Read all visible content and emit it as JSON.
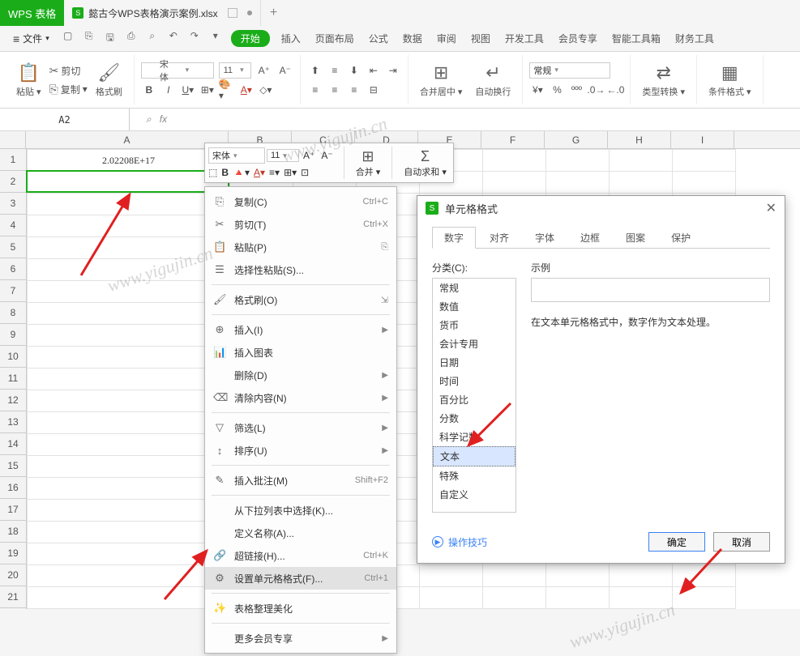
{
  "app": {
    "brand": "WPS 表格"
  },
  "document": {
    "name": "懿古今WPS表格演示案例.xlsx",
    "icon_letter": "S"
  },
  "menubar": {
    "file_label": "文件",
    "quick_icons": [
      "□",
      "⎘",
      "🖨",
      "⟲",
      "⟳",
      "⎌",
      "⎌",
      "▽"
    ],
    "start_tab": "开始",
    "items": [
      "插入",
      "页面布局",
      "公式",
      "数据",
      "审阅",
      "视图",
      "开发工具",
      "会员专享",
      "智能工具箱",
      "财务工具"
    ]
  },
  "ribbon": {
    "paste": "粘贴",
    "cut": "剪切",
    "copy": "复制",
    "format_painter": "格式刷",
    "font_name": "宋体",
    "font_size": "11",
    "merge_center": "合并居中",
    "wrap": "自动换行",
    "number_format": "常规",
    "type_convert": "类型转换",
    "cond_format": "条件格式"
  },
  "formulabar": {
    "cell_ref": "A2",
    "fx": "fx"
  },
  "grid": {
    "columns": [
      "A",
      "B",
      "C",
      "D",
      "E",
      "F",
      "G",
      "H",
      "I"
    ],
    "rows": 21,
    "A1": "2.02208E+17"
  },
  "mini_toolbar": {
    "font_name": "宋体",
    "font_size": "11",
    "merge": "合并",
    "autosum": "自动求和"
  },
  "context_menu": {
    "copy": "复制(C)",
    "copy_sc": "Ctrl+C",
    "cut": "剪切(T)",
    "cut_sc": "Ctrl+X",
    "paste": "粘贴(P)",
    "paste_special": "选择性粘贴(S)...",
    "format_painter": "格式刷(O)",
    "insert": "插入(I)",
    "insert_chart": "插入图表",
    "delete": "删除(D)",
    "clear": "清除内容(N)",
    "filter": "筛选(L)",
    "sort": "排序(U)",
    "insert_comment": "插入批注(M)",
    "comment_sc": "Shift+F2",
    "from_dropdown": "从下拉列表中选择(K)...",
    "define_name": "定义名称(A)...",
    "hyperlink": "超链接(H)...",
    "hyperlink_sc": "Ctrl+K",
    "format_cells": "设置单元格格式(F)...",
    "format_cells_sc": "Ctrl+1",
    "beautify": "表格整理美化",
    "more_member": "更多会员专享"
  },
  "dialog": {
    "title": "单元格格式",
    "icon_letter": "S",
    "tabs": [
      "数字",
      "对齐",
      "字体",
      "边框",
      "图案",
      "保护"
    ],
    "category_label": "分类(C):",
    "categories": [
      "常规",
      "数值",
      "货币",
      "会计专用",
      "日期",
      "时间",
      "百分比",
      "分数",
      "科学记数",
      "文本",
      "特殊",
      "自定义"
    ],
    "selected_category": "文本",
    "example_label": "示例",
    "description": "在文本单元格格式中，数字作为文本处理。",
    "tip": "操作技巧",
    "ok": "确定",
    "cancel": "取消"
  },
  "watermark": "www.yigujin.cn"
}
